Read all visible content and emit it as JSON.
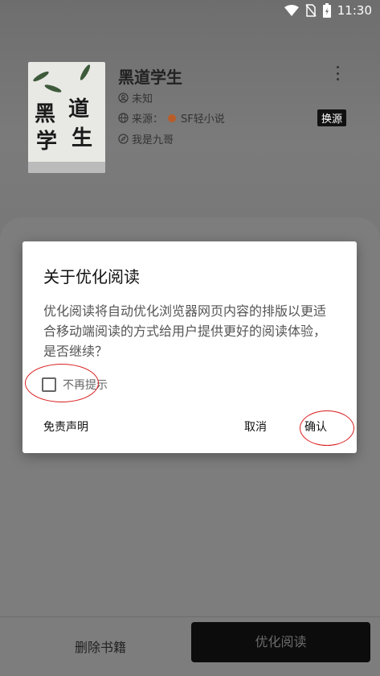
{
  "status_bar": {
    "time": "11:30"
  },
  "book": {
    "title": "黑道学生",
    "author": "未知",
    "source_prefix": "来源：",
    "source_name": "SF轻小说",
    "intro": "我是九哥",
    "change_source": "换源",
    "cover_chars": [
      "道",
      "黑",
      "生",
      "学"
    ]
  },
  "dialog": {
    "title": "关于优化阅读",
    "body": "优化阅读将自动优化浏览器网页内容的排版以更适合移动端阅读的方式给用户提供更好的阅读体验，是否继续？",
    "checkbox_label": "不再提示",
    "disclaimer": "免责声明",
    "cancel": "取消",
    "confirm": "确认"
  },
  "bottom": {
    "delete_label": "删除书籍",
    "optimize_label": "优化阅读"
  },
  "colors": {
    "annotation": "#d81e1e",
    "primary_button": "#0c0c0c"
  }
}
